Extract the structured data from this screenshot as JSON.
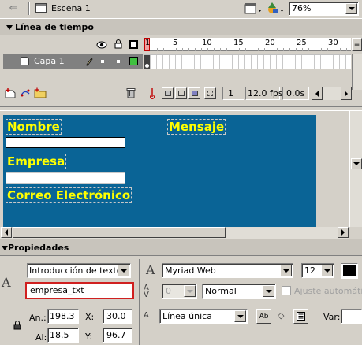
{
  "scene": {
    "name": "Escena 1",
    "zoom": "76%"
  },
  "timeline": {
    "title": "Línea de tiempo",
    "frame_numbers": [
      "1",
      "5",
      "10",
      "15",
      "20",
      "25",
      "30"
    ],
    "layer_name": "Capa 1",
    "current_frame": "1",
    "fps": "12.0 fps",
    "elapsed": "0.0s"
  },
  "stage": {
    "labels": {
      "nombre": "Nombre",
      "mensaje": "Mensaje",
      "empresa": "Empresa",
      "correo": "Correo Electrónico"
    },
    "background_color": "#0a6496",
    "text_color": "#ffff00"
  },
  "properties": {
    "title": "Propiedades",
    "text_type": "Introducción de texto",
    "instance_name": "empresa_txt",
    "font": "Myriad Web",
    "font_size": "12",
    "tracking": "0",
    "kerning_mode": "Normal",
    "auto_kern_label": "Ajuste automático",
    "w_label": "An.:",
    "w_value": "198.3",
    "h_label": "Al:",
    "h_value": "18.5",
    "x_label": "X:",
    "x_value": "30.0",
    "y_label": "Y:",
    "y_value": "96.7",
    "line_type": "Línea única",
    "var_label": "Var:",
    "text_color": "#000000"
  }
}
